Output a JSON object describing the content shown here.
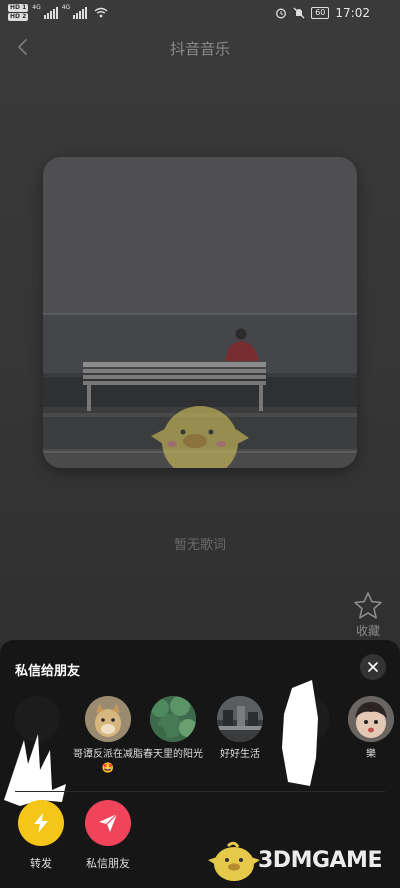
{
  "status_bar": {
    "hd1": "HD 1",
    "hd2": "HD 2",
    "net1": "4G",
    "net2": "4G",
    "battery": "60",
    "time": "17:02"
  },
  "header": {
    "title": "抖音音乐"
  },
  "player": {
    "lyrics_placeholder": "暂无歌词",
    "favorite_label": "收藏"
  },
  "share_sheet": {
    "title": "私信给朋友",
    "friends": [
      {
        "name": ""
      },
      {
        "name": "哥谭反派在减脂🤩"
      },
      {
        "name": "春天里的阳光"
      },
      {
        "name": "好好生活"
      },
      {
        "name": ""
      },
      {
        "name": "樂"
      }
    ],
    "actions": [
      {
        "label": "转发",
        "color": "#f5c518",
        "icon": "lightning-icon"
      },
      {
        "label": "私信朋友",
        "color": "#f0445a",
        "icon": "send-icon"
      }
    ]
  },
  "watermark": {
    "text": "3DMGAME"
  }
}
